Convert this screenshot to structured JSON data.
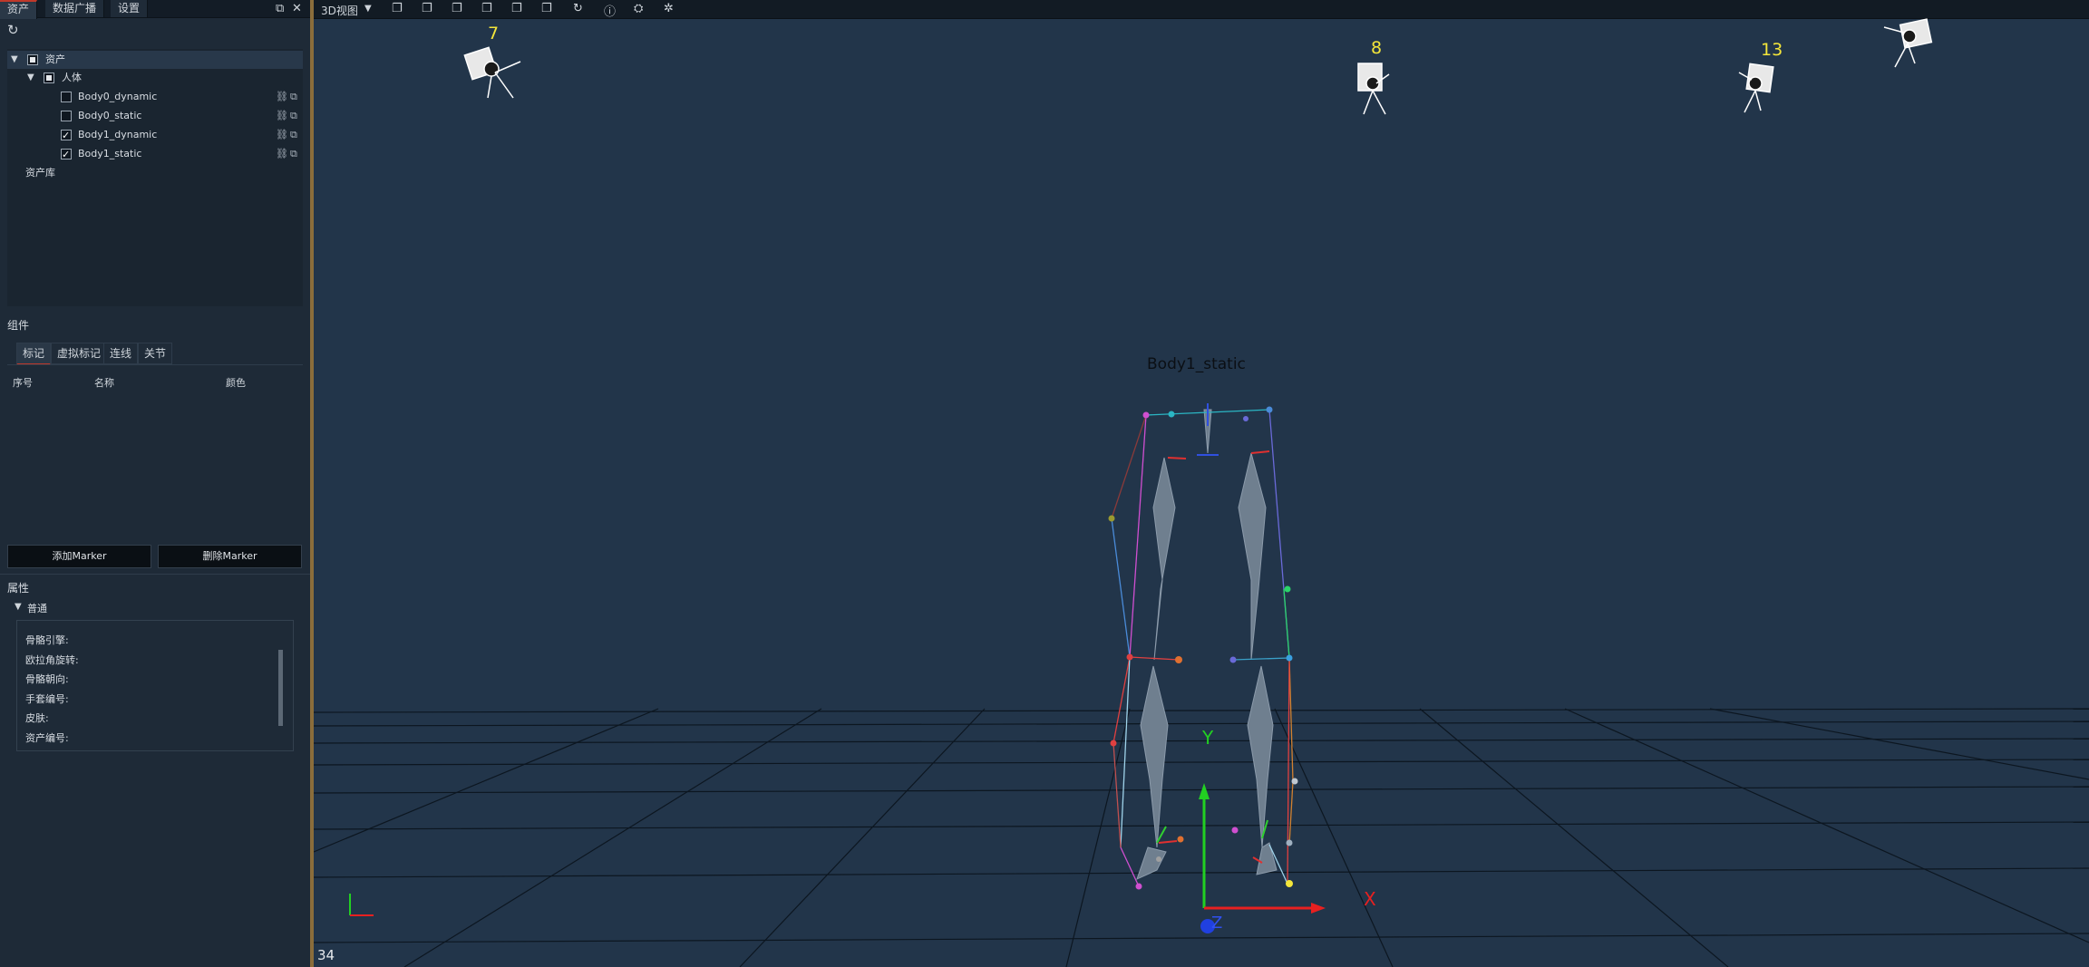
{
  "top_tabs": [
    "资产",
    "数据广播",
    "设置"
  ],
  "asset_tree": {
    "root_label": "资产",
    "group_label": "人体",
    "items": [
      {
        "label": "Body0_dynamic",
        "checked": false
      },
      {
        "label": "Body0_static",
        "checked": false
      },
      {
        "label": "Body1_dynamic",
        "checked": true
      },
      {
        "label": "Body1_static",
        "checked": true
      }
    ],
    "library_label": "资产库"
  },
  "components": {
    "title": "组件",
    "tabs": [
      "标记",
      "虚拟标记",
      "连线",
      "关节"
    ],
    "columns": [
      "序号",
      "名称",
      "颜色"
    ],
    "add_button": "添加Marker",
    "delete_button": "删除Marker"
  },
  "properties": {
    "title": "属性",
    "group": "普通",
    "fields": [
      "骨骼引擎:",
      "欧拉角旋转:",
      "骨骼朝向:",
      "手套编号:",
      "皮肤:",
      "资产编号:"
    ]
  },
  "viewport": {
    "view_mode": "3D视图",
    "camera_numbers": [
      "7",
      "8",
      "13"
    ],
    "body_label": "Body1_static",
    "axes": {
      "x": "X",
      "y": "Y",
      "z": "Z"
    },
    "fps": "34"
  }
}
